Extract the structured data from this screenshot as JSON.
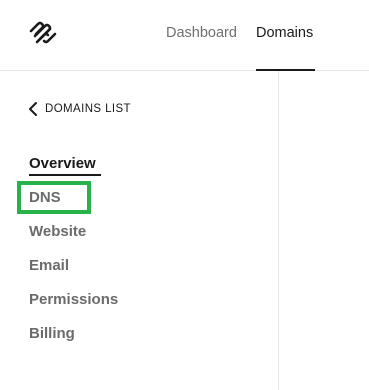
{
  "header": {
    "logo_icon": "squarespace-logo-icon",
    "tabs": [
      {
        "label": "Dashboard",
        "active": false
      },
      {
        "label": "Domains",
        "active": true
      }
    ]
  },
  "sidebar": {
    "back_label": "DOMAINS LIST",
    "back_icon": "chevron-left-icon",
    "items": [
      {
        "label": "Overview",
        "active": true
      },
      {
        "label": "DNS",
        "active": false
      },
      {
        "label": "Website",
        "active": false
      },
      {
        "label": "Email",
        "active": false
      },
      {
        "label": "Permissions",
        "active": false
      },
      {
        "label": "Billing",
        "active": false
      }
    ]
  },
  "colors": {
    "highlight": "#2ab24a",
    "text_active": "#1a1a1a",
    "text_muted": "#6b6b6b"
  }
}
